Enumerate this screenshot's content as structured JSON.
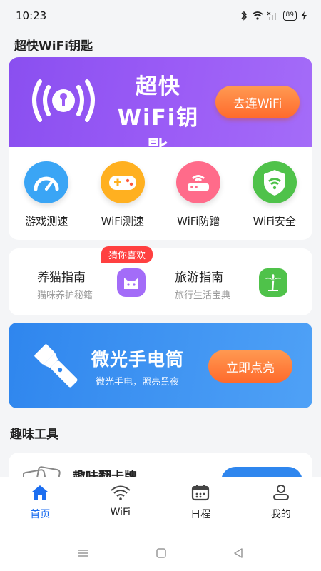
{
  "status_bar": {
    "time": "10:23",
    "battery": "89"
  },
  "page_title": "超快WiFi钥匙",
  "hero": {
    "title_line1": "超快",
    "title_line2": "WiFi钥匙",
    "button_label": "去连WiFi"
  },
  "features": [
    {
      "label": "游戏测速",
      "icon": "speedometer-icon",
      "color": "#3aa5f5"
    },
    {
      "label": "WiFi测速",
      "icon": "gamepad-icon",
      "color": "#ffb020"
    },
    {
      "label": "WiFi防蹭",
      "icon": "router-icon",
      "color": "#ff6b8a"
    },
    {
      "label": "WiFi安全",
      "icon": "wifi-shield-icon",
      "color": "#4fc24a"
    }
  ],
  "guides": {
    "badge": "猜你喜欢",
    "items": [
      {
        "title": "养猫指南",
        "subtitle": "猫咪养护秘籍",
        "icon": "cat-icon",
        "color": "#a36cf8"
      },
      {
        "title": "旅游指南",
        "subtitle": "旅行生活宝典",
        "icon": "palm-tree-icon",
        "color": "#4fc24a"
      }
    ]
  },
  "flashlight": {
    "title": "微光手电筒",
    "subtitle": "微光手电，照亮黑夜",
    "button_label": "立即点亮"
  },
  "section_title": "趣味工具",
  "tool_card": {
    "title": "趣味翻卡牌"
  },
  "tabs": [
    {
      "label": "首页",
      "icon": "home-icon",
      "active": true
    },
    {
      "label": "WiFi",
      "icon": "wifi-icon",
      "active": false
    },
    {
      "label": "日程",
      "icon": "calendar-icon",
      "active": false
    },
    {
      "label": "我的",
      "icon": "user-icon",
      "active": false
    }
  ],
  "colors": {
    "accent": "#1c6ef0",
    "hero_purple": "#9b5cf6",
    "orange_button": "#ff7a36",
    "flash_blue": "#2f86ee"
  }
}
